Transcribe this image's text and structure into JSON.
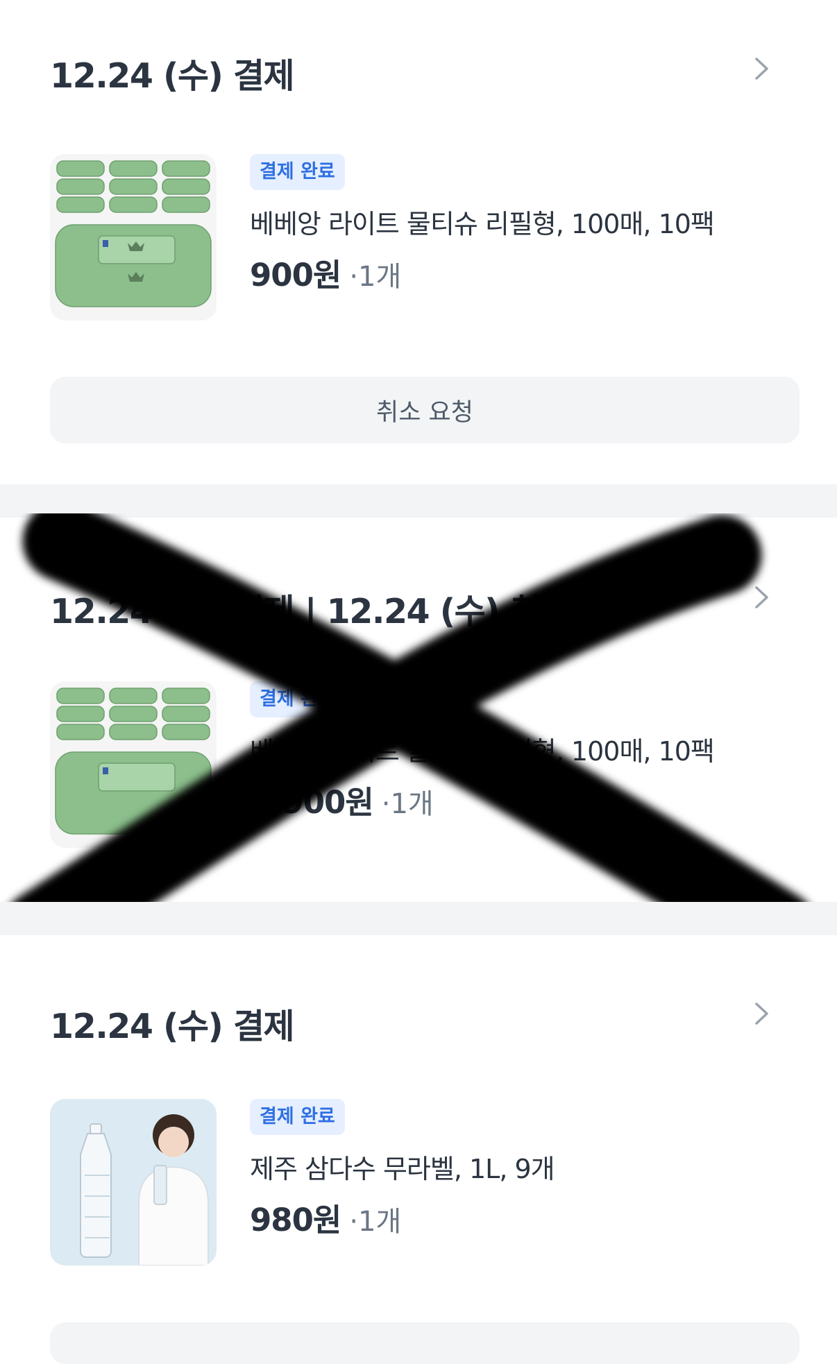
{
  "orders": [
    {
      "header": "12.24 (수) 결제",
      "status": "결제 완료",
      "product_name": "베베앙 라이트 물티슈 리필형, 100매, 10팩",
      "price": "900원",
      "quantity": "·1개",
      "action_label": "취소 요청",
      "thumb_icon": "wet-wipes-icon"
    },
    {
      "header": "12.24 (수) 결제 | 12.24 (수) 취소",
      "status": "결제 완료",
      "product_name": "베베앙 라이트 물티슈 리필형, 100매, 10팩",
      "price": "4,900원",
      "quantity": "·1개",
      "thumb_icon": "wet-wipes-icon",
      "crossed_out": true
    },
    {
      "header": "12.24 (수) 결제",
      "status": "결제 완료",
      "product_name": "제주 삼다수 무라벨, 1L, 9개",
      "price": "980원",
      "quantity": "·1개",
      "thumb_icon": "water-bottle-icon"
    }
  ],
  "colors": {
    "badge_bg": "#e6efff",
    "badge_text": "#2e6fe3",
    "divider": "#f2f4f6",
    "button_bg": "#f2f4f6",
    "wipes_green": "#8cbf8c"
  }
}
